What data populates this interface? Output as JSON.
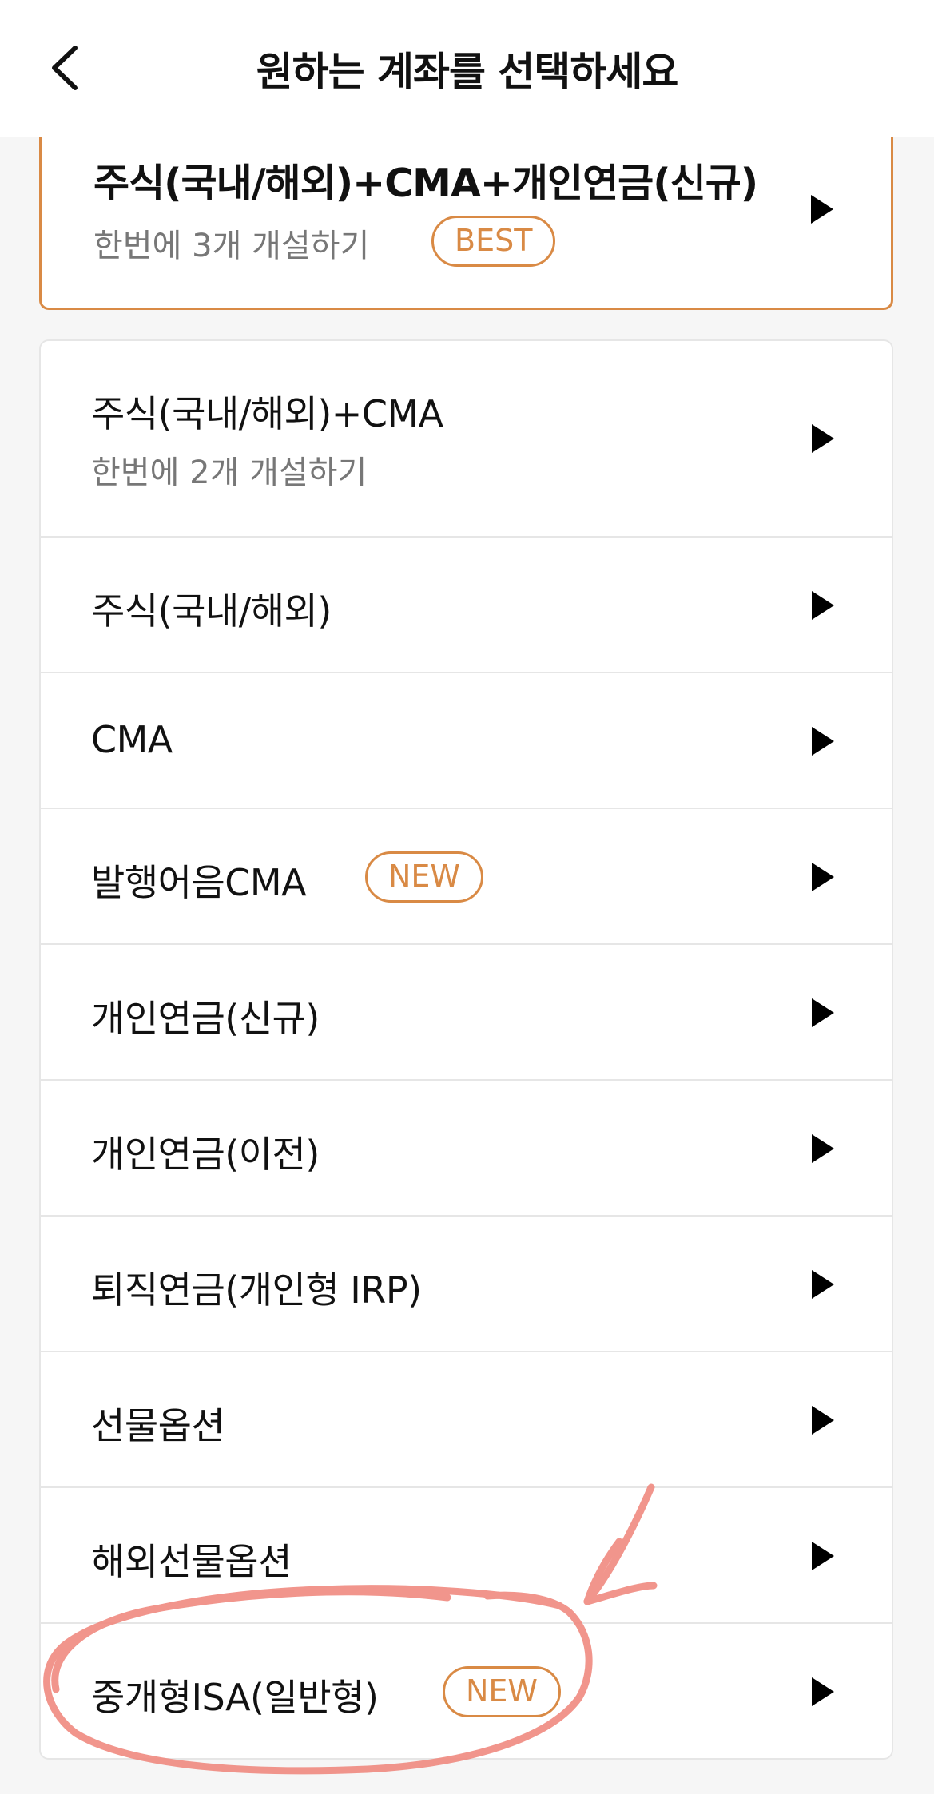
{
  "header": {
    "title": "원하는 계좌를 선택하세요"
  },
  "featured": {
    "title": "주식(국내/해외)+CMA+개인연금(신규)",
    "subtitle": "한번에 3개 개설하기",
    "badge": "BEST"
  },
  "items": [
    {
      "label": "주식(국내/해외)+CMA",
      "subtitle": "한번에 2개 개설하기"
    },
    {
      "label": "주식(국내/해외)"
    },
    {
      "label": "CMA"
    },
    {
      "label": "발행어음CMA",
      "badge": "NEW"
    },
    {
      "label": "개인연금(신규)"
    },
    {
      "label": "개인연금(이전)"
    },
    {
      "label": "퇴직연금(개인형 IRP)"
    },
    {
      "label": "선물옵션"
    },
    {
      "label": "해외선물옵션"
    },
    {
      "label": "중개형ISA(일반형)",
      "badge": "NEW"
    }
  ],
  "colors": {
    "accent": "#d98a45",
    "annotation": "#f08a80",
    "background": "#f6f6f6"
  },
  "icons": {
    "back": "chevron-left-icon",
    "row_arrow": "play-triangle-icon"
  }
}
